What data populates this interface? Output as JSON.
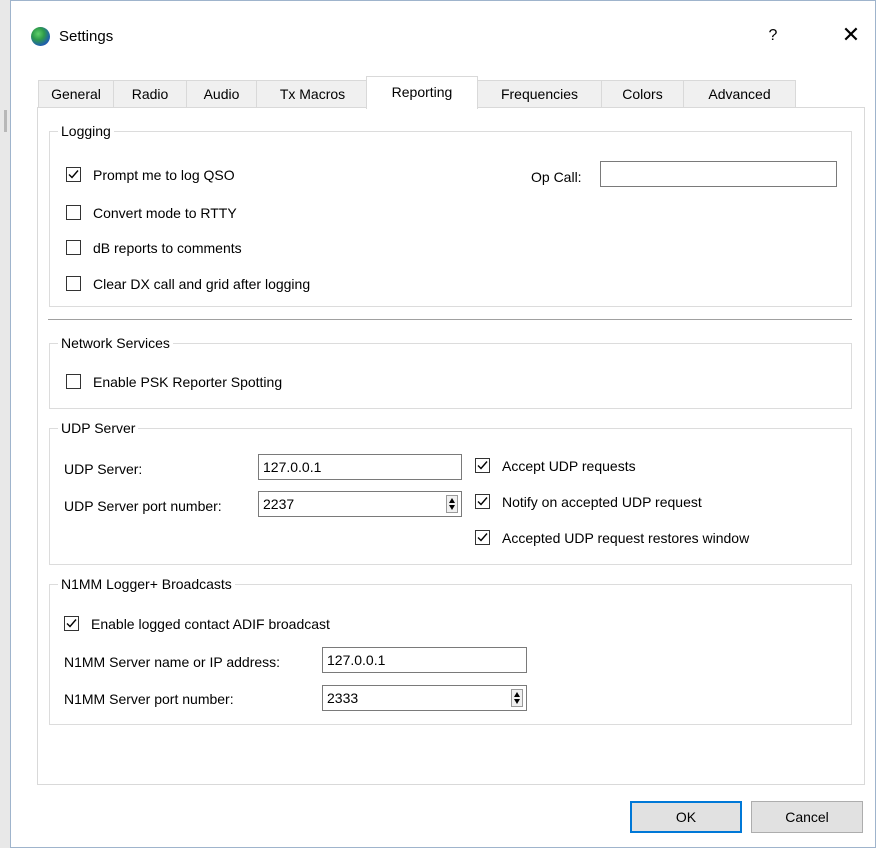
{
  "window": {
    "title": "Settings",
    "help_glyph": "?",
    "close_glyph": "✕"
  },
  "tabs": [
    {
      "label": "General",
      "active": false
    },
    {
      "label": "Radio",
      "active": false
    },
    {
      "label": "Audio",
      "active": false
    },
    {
      "label": "Tx Macros",
      "active": false
    },
    {
      "label": "Reporting",
      "active": true
    },
    {
      "label": "Frequencies",
      "active": false
    },
    {
      "label": "Colors",
      "active": false
    },
    {
      "label": "Advanced",
      "active": false
    }
  ],
  "logging": {
    "title": "Logging",
    "prompt_log_qso": {
      "label": "Prompt me to log QSO",
      "checked": true
    },
    "convert_mode_rtty": {
      "label": "Convert mode to RTTY",
      "checked": false
    },
    "db_reports_comments": {
      "label": "dB reports to comments",
      "checked": false
    },
    "clear_dx_call": {
      "label": "Clear DX call and grid after logging",
      "checked": false
    },
    "op_call_label": "Op Call:",
    "op_call_value": ""
  },
  "network_services": {
    "title": "Network Services",
    "psk_reporter": {
      "label": "Enable PSK Reporter Spotting",
      "checked": false
    }
  },
  "udp_server": {
    "title": "UDP Server",
    "server_label": "UDP Server:",
    "server_value": "127.0.0.1",
    "port_label": "UDP Server port number:",
    "port_value": "2237",
    "accept_requests": {
      "label": "Accept UDP requests",
      "checked": true
    },
    "notify_accepted": {
      "label": "Notify on accepted UDP request",
      "checked": true
    },
    "restores_window": {
      "label": "Accepted UDP request restores window",
      "checked": true
    }
  },
  "n1mm": {
    "title": "N1MM Logger+ Broadcasts",
    "enable_adif": {
      "label": "Enable logged contact ADIF broadcast",
      "checked": true
    },
    "server_label": "N1MM Server name or IP address:",
    "server_value": "127.0.0.1",
    "port_label": "N1MM Server port number:",
    "port_value": "2333"
  },
  "buttons": {
    "ok": "OK",
    "cancel": "Cancel"
  },
  "colors": {
    "accent": "#0078d7",
    "tab_inactive": "#f0f0f0",
    "button_face": "#e1e1e1"
  },
  "icons": {
    "app": "globe-icon",
    "help": "help-icon",
    "close": "close-icon",
    "check": "checkmark-icon",
    "spin": "spin-arrows-icon"
  }
}
